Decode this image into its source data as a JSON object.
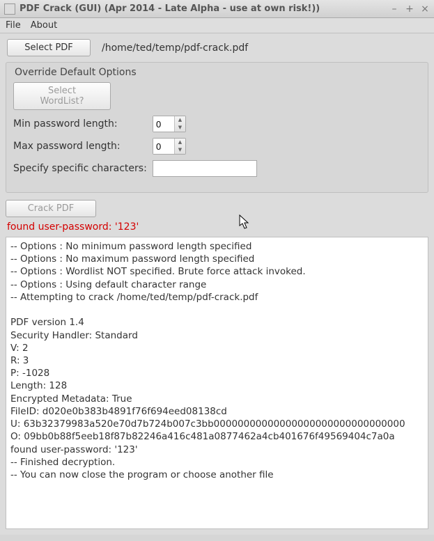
{
  "window": {
    "title": "PDF Crack (GUI) (Apr 2014 - Late Alpha - use at own risk!))"
  },
  "menu": {
    "file": "File",
    "about": "About"
  },
  "top": {
    "select_pdf": "Select PDF",
    "path": "/home/ted/temp/pdf-crack.pdf"
  },
  "options": {
    "title": "Override Default Options",
    "select_wordlist": "Select WordList?",
    "min_label": "Min password length:",
    "min_value": "0",
    "max_label": "Max password length:",
    "max_value": "0",
    "chars_label": "Specify specific characters:",
    "chars_value": ""
  },
  "actions": {
    "crack": "Crack PDF"
  },
  "status": "found user-password: '123'",
  "output_text": "-- Options : No minimum password length specified\n-- Options : No maximum password length specified\n-- Options : Wordlist NOT specified. Brute force attack invoked.\n-- Options : Using default character range\n-- Attempting to crack /home/ted/temp/pdf-crack.pdf\n\nPDF version 1.4\nSecurity Handler: Standard\nV: 2\nR: 3\nP: -1028\nLength: 128\nEncrypted Metadata: True\nFileID: d020e0b383b4891f76f694eed08138cd\nU: 63b32379983a520e70d7b724b007c3bb00000000000000000000000000000000\nO: 09bb0b88f5eeb18f87b82246a416c481a0877462a4cb401676f49569404c7a0a\nfound user-password: '123'\n-- Finished decryption.\n-- You can now close the program or choose another file"
}
